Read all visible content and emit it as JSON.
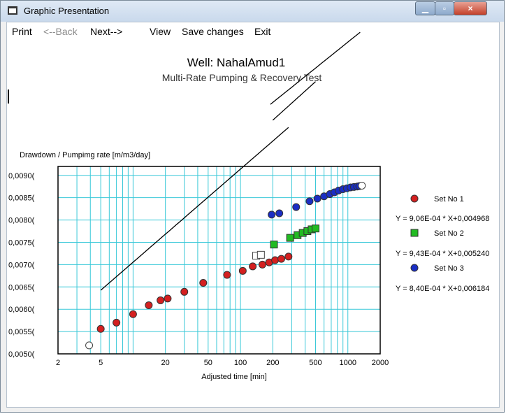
{
  "window": {
    "title": "Graphic Presentation",
    "close_glyph": "×",
    "min_glyph": "▁",
    "max_glyph": "▫"
  },
  "menu": {
    "print": "Print",
    "back": "<--Back",
    "next": "Next-->",
    "view": "View",
    "save": "Save changes",
    "exit": "Exit"
  },
  "chart_data": {
    "type": "scatter",
    "title": "Well: NahalAmud1",
    "subtitle": "Multi-Rate Pumping & Recovery Test",
    "xlabel": "Adjusted time [min]",
    "ylabel": "Drawdown / Pumpimg rate [m/m3/day]",
    "xscale": "log",
    "xlim": [
      2,
      2000
    ],
    "ylim": [
      0.005,
      0.0092
    ],
    "x_ticks": [
      2,
      5,
      20,
      50,
      200,
      500,
      1000,
      2000
    ],
    "x_tick_labels": [
      "2",
      "5",
      "20",
      "50",
      "100",
      "200",
      "500",
      "1000",
      "2000"
    ],
    "x_tick_values": [
      2,
      5,
      20,
      50,
      100,
      200,
      500,
      1000,
      2000
    ],
    "y_tick_values": [
      0.005,
      0.0055,
      0.006,
      0.0065,
      0.007,
      0.0075,
      0.008,
      0.0085,
      0.009
    ],
    "y_tick_labels": [
      "0,0050(",
      "0,0055(",
      "0,0060(",
      "0,0065(",
      "0,0070(",
      "0,0075(",
      "0,0080(",
      "0,0085(",
      "0,0090("
    ],
    "grid": true,
    "legend_position": "right",
    "series": [
      {
        "name": "Set No 1",
        "marker": "circle",
        "color": "#d42020",
        "fit": "Y = 9,06E-04 * X+0,004968",
        "fit_coef": [
          0.000906,
          0.004968
        ],
        "fit_range": [
          5,
          280
        ],
        "x": [
          5,
          7,
          10,
          14,
          18,
          21,
          30,
          45,
          75,
          105,
          130,
          160,
          185,
          210,
          240,
          280
        ],
        "y": [
          0.00556,
          0.0057,
          0.00589,
          0.00609,
          0.0062,
          0.00624,
          0.00639,
          0.00659,
          0.00677,
          0.00686,
          0.00696,
          0.007,
          0.00705,
          0.0071,
          0.00713,
          0.00718
        ]
      },
      {
        "name": "Set No 2",
        "marker": "square",
        "color": "#22bb22",
        "fit": "Y = 9,43E-04 * X+0,005240",
        "fit_coef": [
          0.000943,
          0.00524
        ],
        "fit_range": [
          200,
          500
        ],
        "x": [
          205,
          290,
          340,
          380,
          420,
          460,
          500
        ],
        "y": [
          0.00745,
          0.0076,
          0.00766,
          0.00771,
          0.00775,
          0.00779,
          0.00781
        ]
      },
      {
        "name": "Set No 3",
        "marker": "circle",
        "color": "#1a2ec4",
        "fit": "Y = 8,40E-04 * X+0,006184",
        "fit_coef": [
          0.00084,
          0.006184
        ],
        "fit_range": [
          190,
          1300
        ],
        "x": [
          195,
          230,
          330,
          440,
          520,
          600,
          680,
          750,
          820,
          900,
          980,
          1060,
          1140,
          1220,
          1280
        ],
        "y": [
          0.00812,
          0.00815,
          0.00829,
          0.00842,
          0.00848,
          0.00853,
          0.00858,
          0.00862,
          0.00866,
          0.00869,
          0.00871,
          0.00873,
          0.00874,
          0.00875,
          0.00876
        ]
      }
    ],
    "open_points": [
      {
        "marker": "circle",
        "x": 3.9,
        "y": 0.00519
      },
      {
        "marker": "square",
        "x": 140,
        "y": 0.0072
      },
      {
        "marker": "square",
        "x": 155,
        "y": 0.00722
      },
      {
        "marker": "circle",
        "x": 1350,
        "y": 0.00877
      }
    ]
  }
}
